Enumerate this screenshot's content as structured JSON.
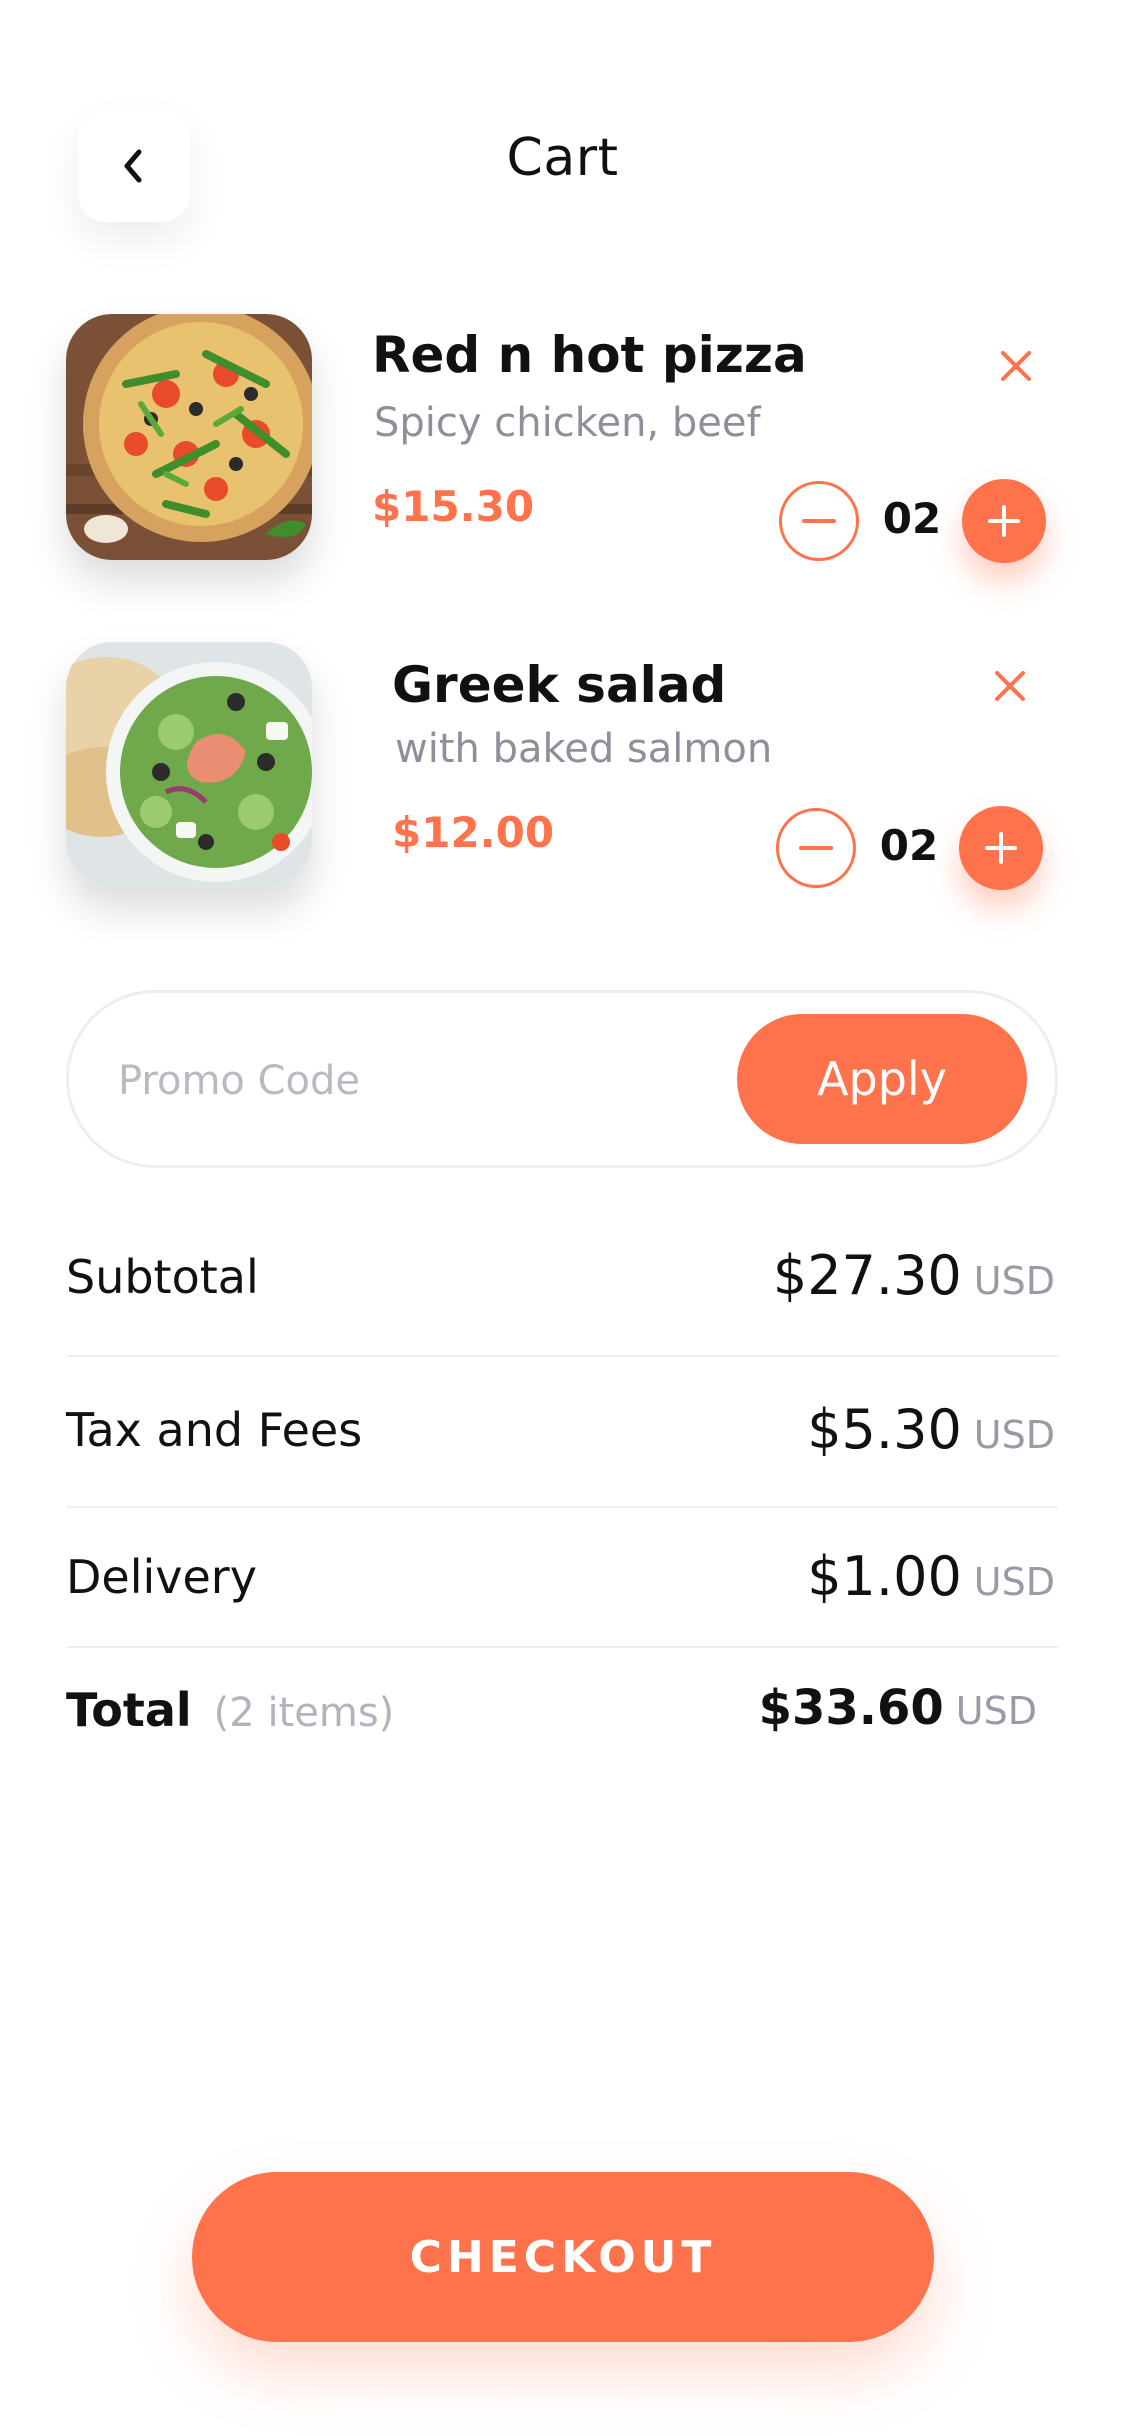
{
  "header": {
    "title": "Cart"
  },
  "items": [
    {
      "name": "Red n hot pizza",
      "description": "Spicy chicken, beef",
      "price": "$15.30",
      "quantity": "02"
    },
    {
      "name": "Greek salad",
      "description": "with baked salmon",
      "price": "$12.00",
      "quantity": "02"
    }
  ],
  "promo": {
    "placeholder": "Promo Code",
    "apply_label": "Apply"
  },
  "summary": {
    "subtotal_label": "Subtotal",
    "subtotal_amount": "$27.30",
    "subtotal_unit": "USD",
    "tax_label": "Tax and Fees",
    "tax_amount": "$5.30",
    "tax_unit": "USD",
    "delivery_label": "Delivery",
    "delivery_amount": "$1.00",
    "delivery_unit": "USD",
    "total_label": "Total",
    "total_note": "(2 items)",
    "total_amount": "$33.60",
    "total_unit": "USD"
  },
  "checkout_label": "CHECKOUT",
  "colors": {
    "accent": "#fe724c",
    "muted_text": "#8f8f9c",
    "divider": "#efefef"
  },
  "icons": [
    "back-chevron-icon",
    "close-icon",
    "minus-icon",
    "plus-icon"
  ]
}
